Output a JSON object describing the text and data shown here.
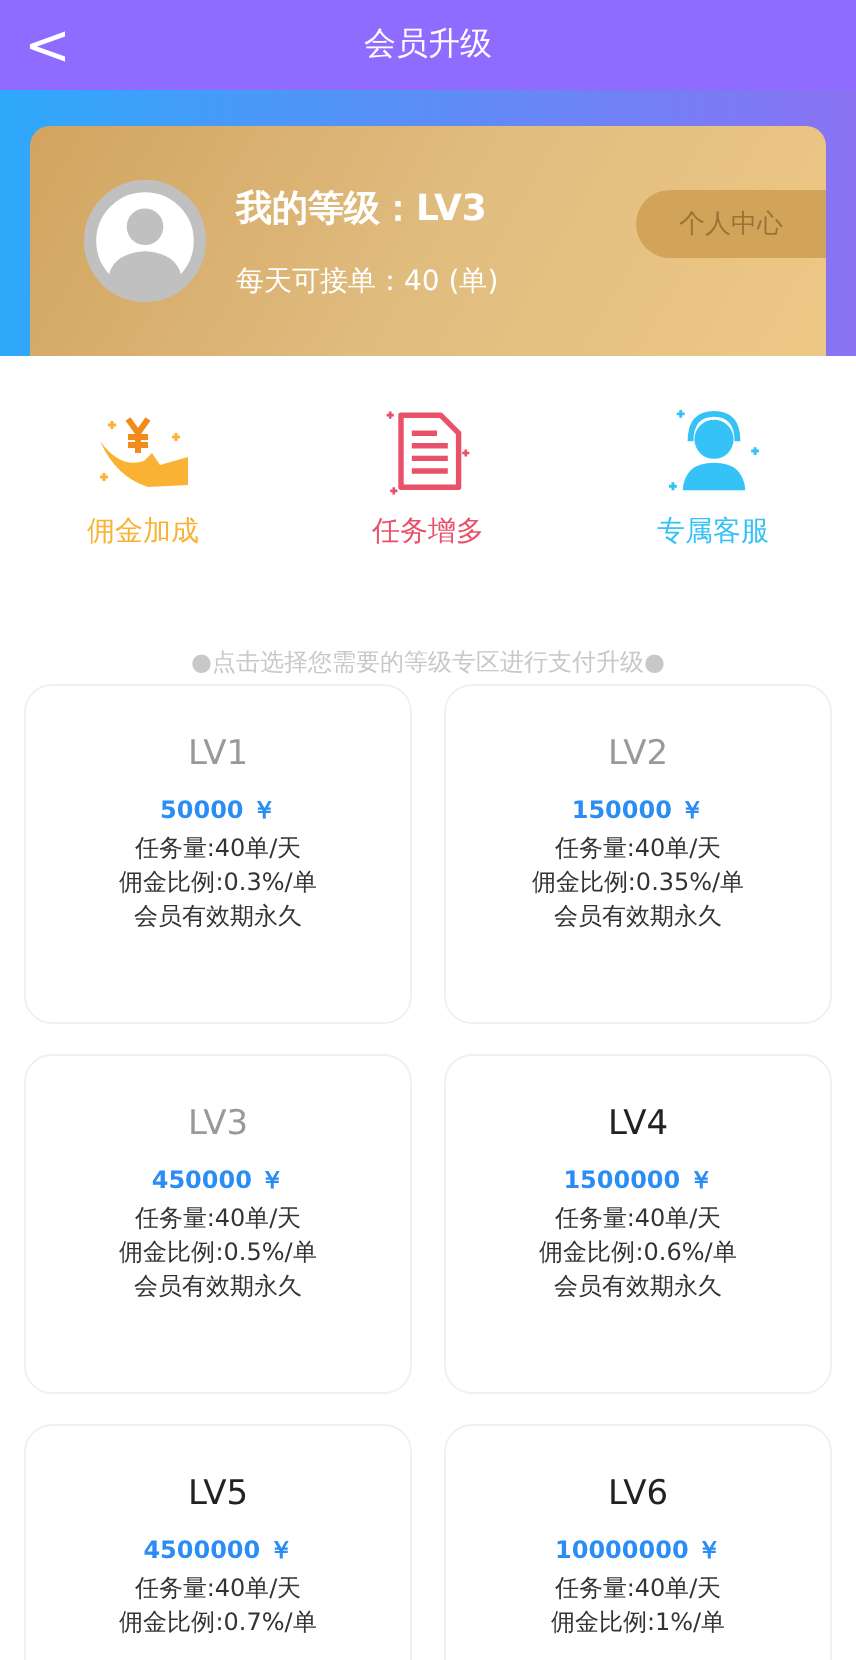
{
  "header": {
    "back": "<",
    "title": "会员升级"
  },
  "profile": {
    "level_text": "我的等级：LV3",
    "daily_orders": "每天可接单：40 (单)",
    "center_button": "个人中心"
  },
  "features": [
    {
      "kind": "commission",
      "label": "佣金加成",
      "color": "#f9b233"
    },
    {
      "kind": "tasks",
      "label": "任务增多",
      "color": "#e9506a"
    },
    {
      "kind": "service",
      "label": "专属客服",
      "color": "#35c2f6"
    }
  ],
  "hint": "●点击选择您需要的等级专区进行支付升级●",
  "levels": [
    {
      "name": "LV1",
      "owned": true,
      "price": "50000 ￥",
      "lines": [
        "任务量:40单/天",
        "佣金比例:0.3%/单",
        "会员有效期永久"
      ]
    },
    {
      "name": "LV2",
      "owned": true,
      "price": "150000 ￥",
      "lines": [
        "任务量:40单/天",
        "佣金比例:0.35%/单",
        "会员有效期永久"
      ]
    },
    {
      "name": "LV3",
      "owned": true,
      "price": "450000 ￥",
      "lines": [
        "任务量:40单/天",
        "佣金比例:0.5%/单",
        "会员有效期永久"
      ]
    },
    {
      "name": "LV4",
      "owned": false,
      "price": "1500000 ￥",
      "lines": [
        "任务量:40单/天",
        "佣金比例:0.6%/单",
        "会员有效期永久"
      ]
    },
    {
      "name": "LV5",
      "owned": false,
      "price": "4500000 ￥",
      "lines": [
        "任务量:40单/天",
        "佣金比例:0.7%/单"
      ]
    },
    {
      "name": "LV6",
      "owned": false,
      "price": "10000000 ￥",
      "lines": [
        "任务量:40单/天",
        "佣金比例:1%/单"
      ]
    }
  ]
}
